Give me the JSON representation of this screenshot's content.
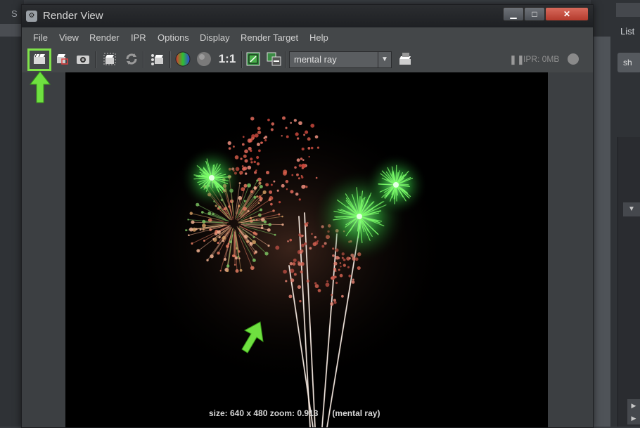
{
  "background": {
    "left_label": "S",
    "right_label": "List",
    "right_tab": "sh"
  },
  "window": {
    "title": "Render View",
    "controls": {
      "minimize": "▁",
      "maximize": "□",
      "close": "✕"
    }
  },
  "menu": [
    "File",
    "View",
    "Render",
    "IPR",
    "Options",
    "Display",
    "Render Target",
    "Help"
  ],
  "toolbar": {
    "real_size_label": "1:1",
    "renderer_value": "mental ray",
    "ipr_status": "IPR: 0MB",
    "icons": [
      "render-frame-icon",
      "redo-render-icon",
      "snapshot-icon",
      "render-region-icon",
      "refresh-icon",
      "ipr-render-icon",
      "color-channels-icon",
      "alpha-channel-icon",
      "keep-image-icon",
      "remove-image-icon",
      "render-settings-icon"
    ]
  },
  "render": {
    "status": "size: 640 x 480 zoom: 0.913      (mental ray)"
  },
  "colors": {
    "highlight": "#7fe24a",
    "arrow": "#6fe040",
    "close": "#c2473a"
  }
}
